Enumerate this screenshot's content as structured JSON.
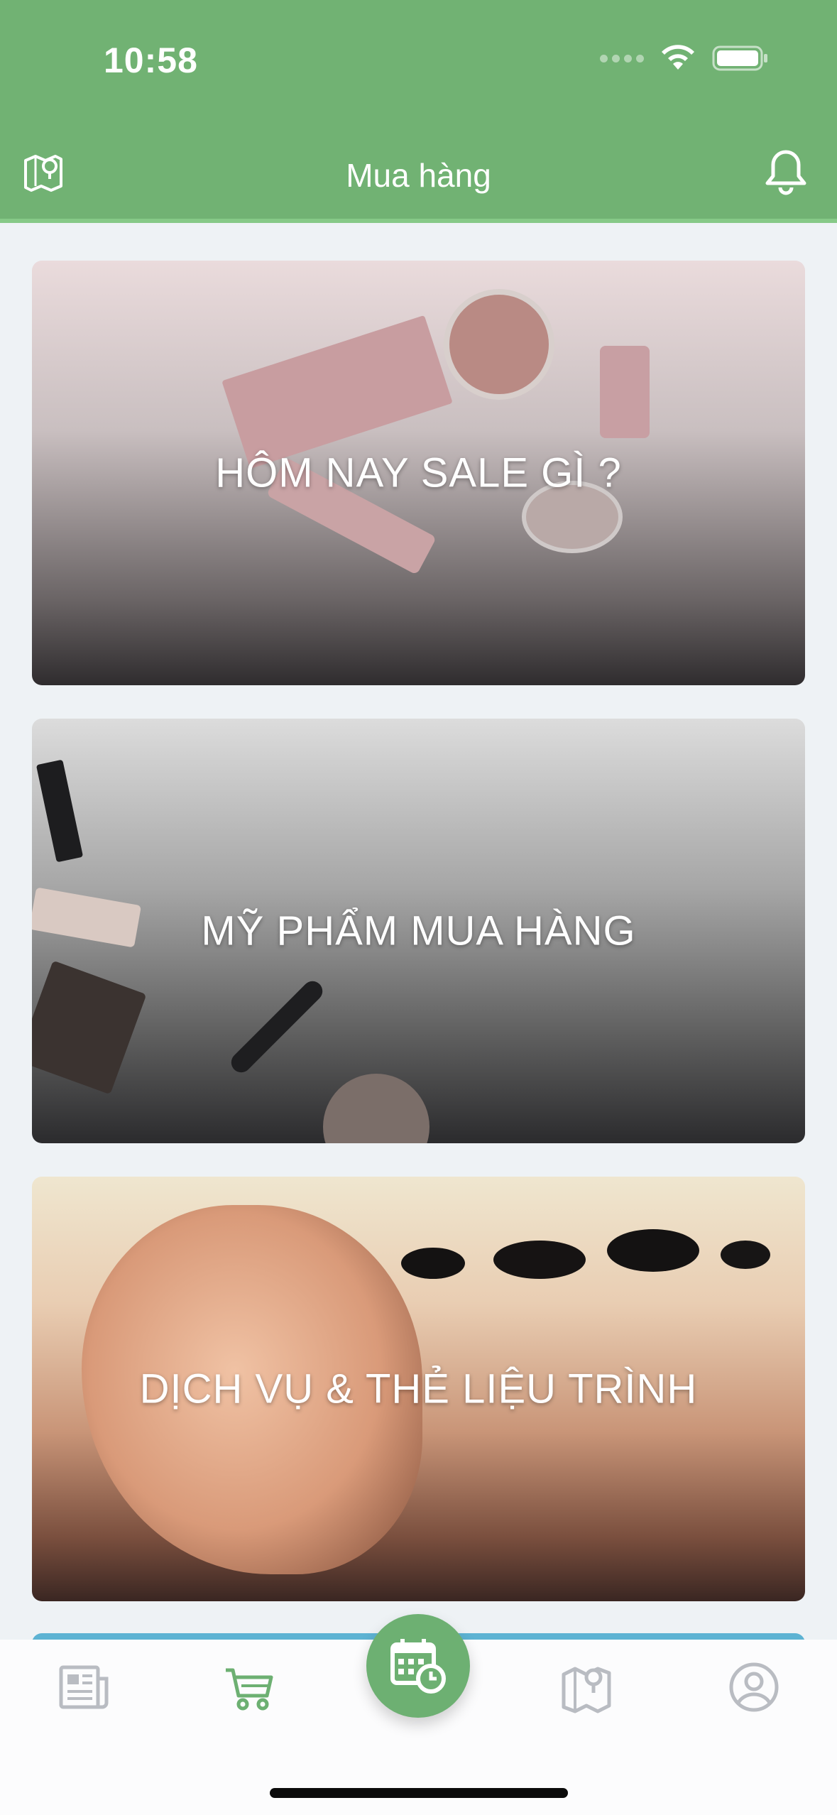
{
  "status_bar": {
    "time": "10:58"
  },
  "header": {
    "title": "Mua hàng"
  },
  "cards": [
    {
      "label": "HÔM NAY SALE GÌ ?"
    },
    {
      "label": "MỸ PHẨM MUA HÀNG"
    },
    {
      "label": "DỊCH VỤ & THẺ LIỆU TRÌNH"
    }
  ],
  "tabbar": {
    "items": [
      "news-icon",
      "cart-icon",
      "calendar-clock-icon",
      "map-icon",
      "profile-icon"
    ],
    "active": "cart-icon",
    "active_color": "#6db072",
    "inactive_color": "#b9bcc2"
  },
  "colors": {
    "header": "#71b273",
    "background": "#eef2f5"
  }
}
